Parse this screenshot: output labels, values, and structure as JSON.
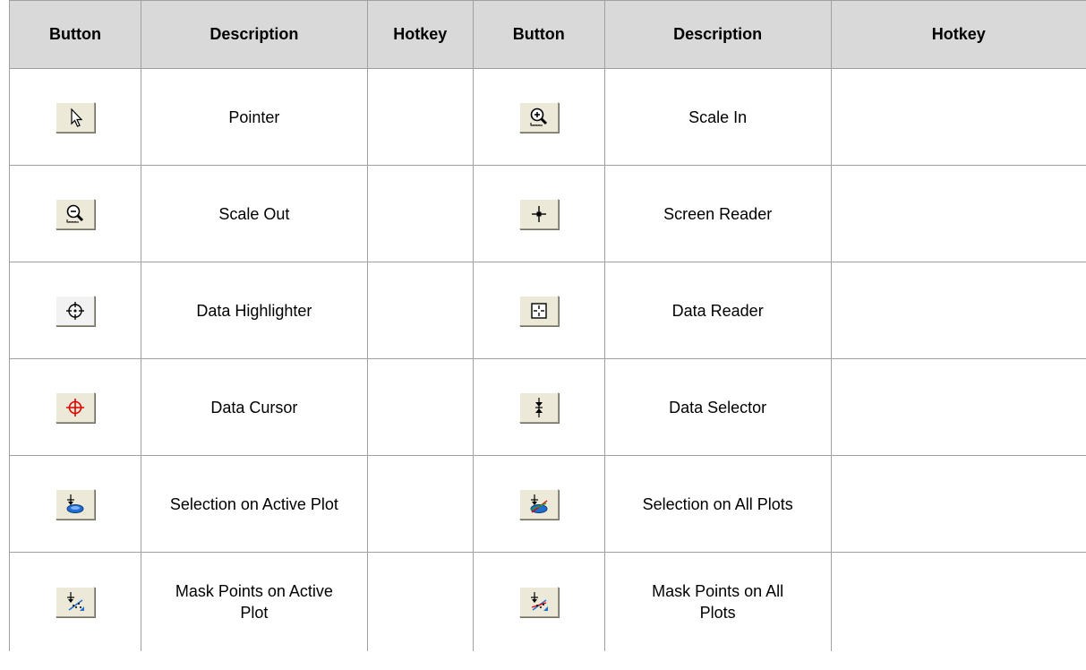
{
  "headers": [
    "Button",
    "Description",
    "Hotkey",
    "Button",
    "Description",
    "Hotkey"
  ],
  "rows": [
    {
      "left": {
        "icon": "pointer-icon",
        "description": "Pointer",
        "hotkey": ""
      },
      "right": {
        "icon": "scale-in-icon",
        "description": "Scale In",
        "hotkey": ""
      }
    },
    {
      "left": {
        "icon": "scale-out-icon",
        "description": "Scale Out",
        "hotkey": ""
      },
      "right": {
        "icon": "screen-reader-icon",
        "description": "Screen Reader",
        "hotkey": ""
      }
    },
    {
      "left": {
        "icon": "data-highlighter-icon",
        "description": "Data Highlighter",
        "hotkey": ""
      },
      "right": {
        "icon": "data-reader-icon",
        "description": "Data Reader",
        "hotkey": ""
      }
    },
    {
      "left": {
        "icon": "data-cursor-icon",
        "description": "Data Cursor",
        "hotkey": ""
      },
      "right": {
        "icon": "data-selector-icon",
        "description": "Data Selector",
        "hotkey": ""
      }
    },
    {
      "left": {
        "icon": "selection-on-active-plot-icon",
        "description": "Selection on Active Plot",
        "hotkey": ""
      },
      "right": {
        "icon": "selection-on-all-plots-icon",
        "description": "Selection on All Plots",
        "hotkey": ""
      }
    },
    {
      "left": {
        "icon": "mask-points-on-active-plot-icon",
        "description": "Mask Points on Active Plot",
        "hotkey": ""
      },
      "right": {
        "icon": "mask-points-on-all-plots-icon",
        "description": "Mask Points on All Plots",
        "hotkey": ""
      }
    }
  ],
  "colors": {
    "header_bg": "#d9d9d9",
    "border": "#a0a0a0",
    "button_face": "#ece9d8",
    "cursor_red": "#e00000",
    "selection_blue": "#1f6fd0"
  }
}
